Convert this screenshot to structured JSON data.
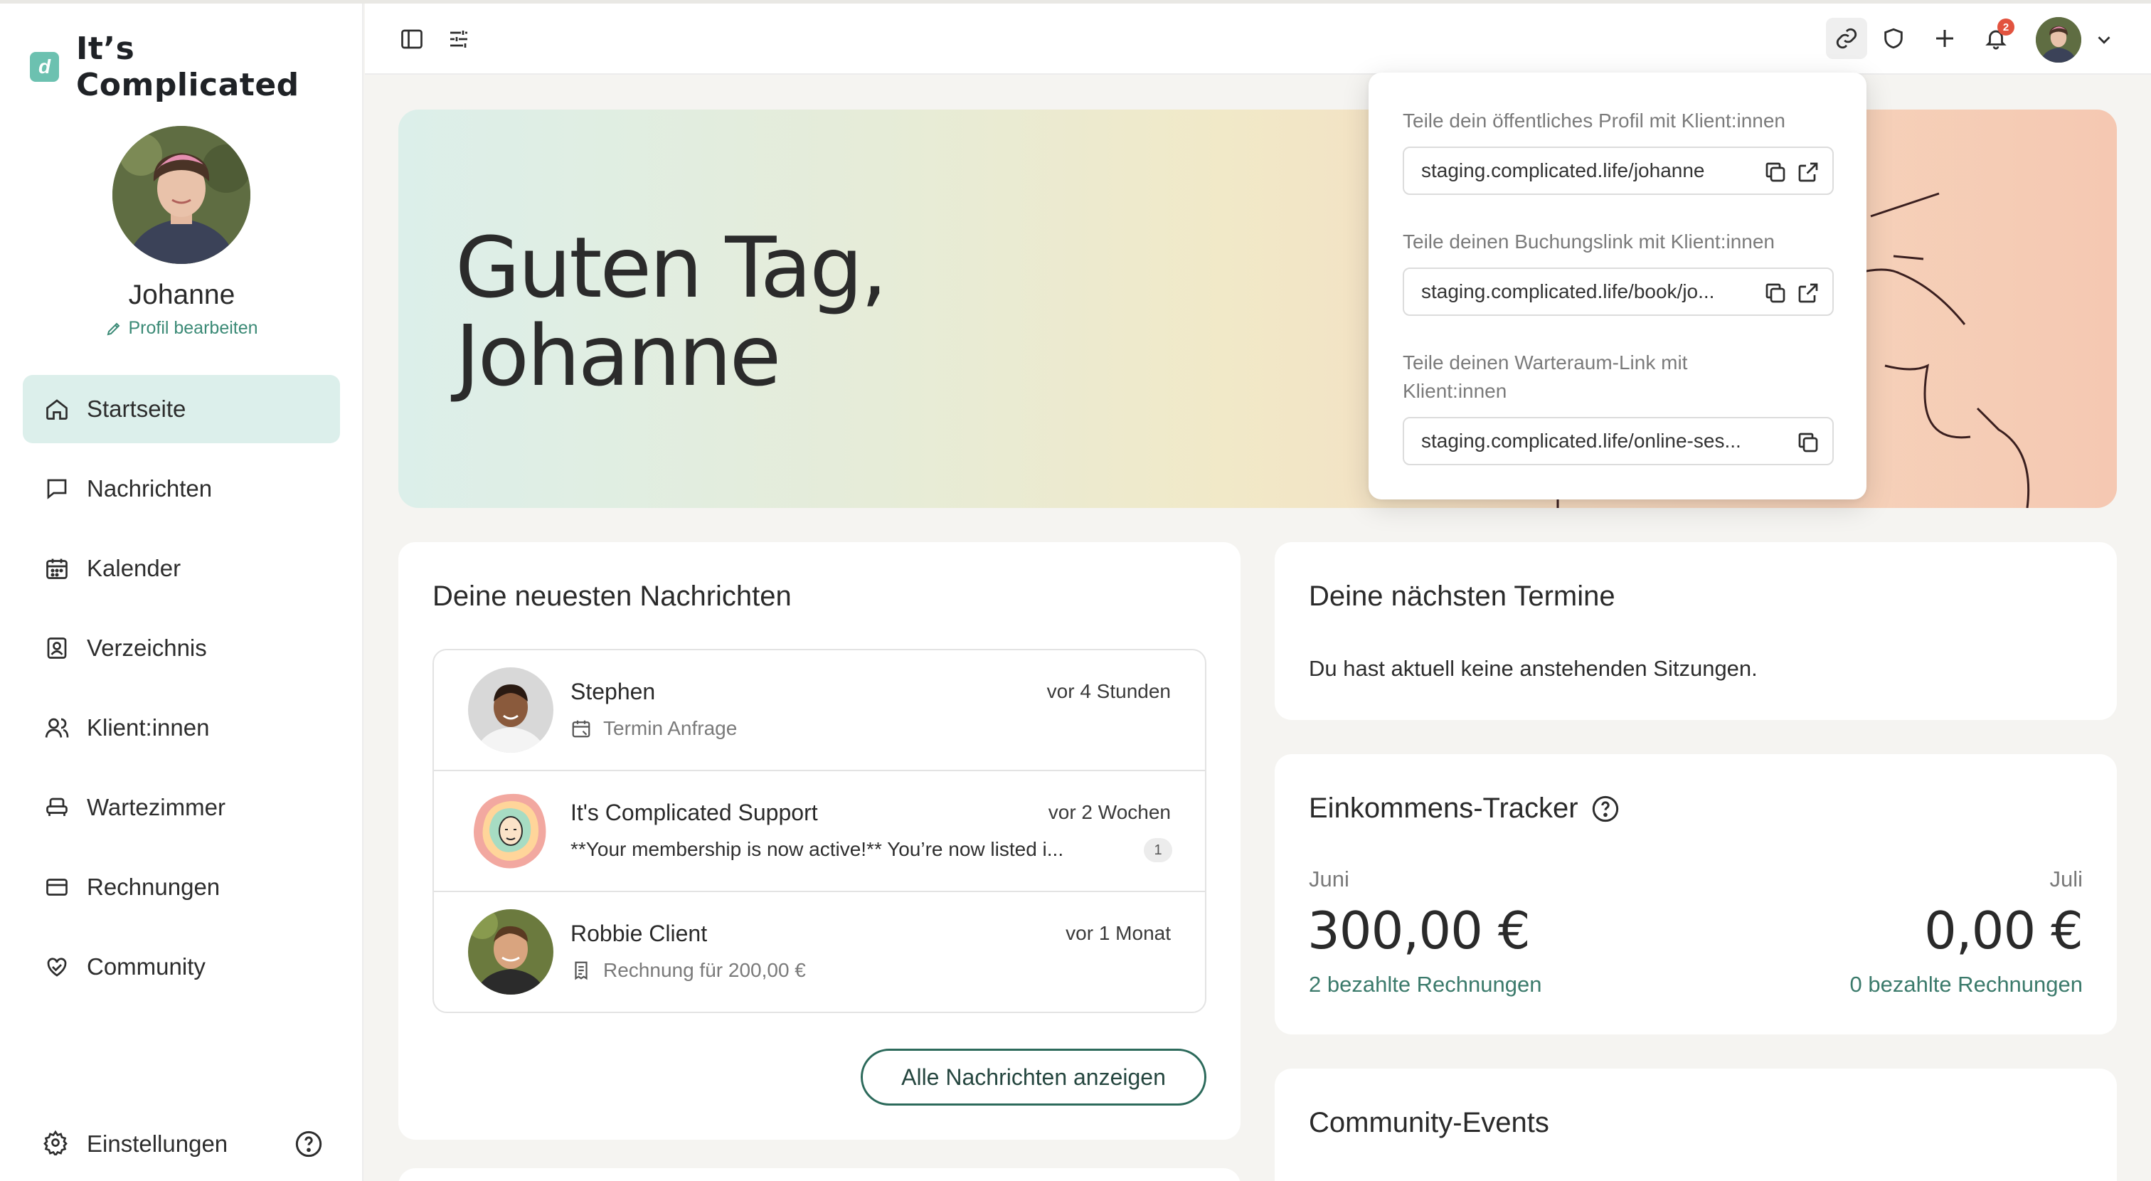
{
  "app": {
    "name": "It’s Complicated"
  },
  "profile": {
    "name": "Johanne",
    "edit_label": "Profil bearbeiten"
  },
  "sidebar": {
    "items": [
      {
        "label": "Startseite",
        "icon": "home-icon",
        "active": true
      },
      {
        "label": "Nachrichten",
        "icon": "chat-icon"
      },
      {
        "label": "Kalender",
        "icon": "calendar-icon"
      },
      {
        "label": "Verzeichnis",
        "icon": "directory-icon"
      },
      {
        "label": "Klient:innen",
        "icon": "clients-icon"
      },
      {
        "label": "Wartezimmer",
        "icon": "waiting-room-icon"
      },
      {
        "label": "Rechnungen",
        "icon": "invoice-icon"
      },
      {
        "label": "Community",
        "icon": "community-icon"
      }
    ],
    "settings_label": "Einstellungen"
  },
  "topbar": {
    "notification_count": "2"
  },
  "hero": {
    "greeting_line1": "Guten Tag,",
    "greeting_line2": "Johanne"
  },
  "share_popover": {
    "profile_label": "Teile dein öffentliches Profil mit Klient:innen",
    "profile_url": "staging.complicated.life/johanne",
    "booking_label": "Teile deinen Buchungslink mit Klient:innen",
    "booking_url": "staging.complicated.life/book/jo...",
    "waiting_label": "Teile deinen Warteraum-Link mit Klient:innen",
    "waiting_url": "staging.complicated.life/online-ses..."
  },
  "messages": {
    "title": "Deine neuesten Nachrichten",
    "items": [
      {
        "name": "Stephen",
        "time": "vor 4 Stunden",
        "subtitle": "Termin Anfrage",
        "icon": "calendar-icon"
      },
      {
        "name": "It's Complicated Support",
        "time": "vor 2 Wochen",
        "preview": "**Your membership is now active!** You’re now listed i...",
        "count": "1"
      },
      {
        "name": "Robbie Client",
        "time": "vor 1 Monat",
        "subtitle": "Rechnung für 200,00 €",
        "icon": "invoice-icon"
      }
    ],
    "show_all_label": "Alle Nachrichten anzeigen"
  },
  "appointments": {
    "title": "Deine nächsten Termine",
    "empty_text": "Du hast aktuell keine anstehenden Sitzungen."
  },
  "income": {
    "title": "Einkommens-Tracker",
    "left": {
      "month": "Juni",
      "amount": "300,00 €",
      "paid": "2 bezahlte Rechnungen"
    },
    "right": {
      "month": "Juli",
      "amount": "0,00 €",
      "paid": "0 bezahlte Rechnungen"
    }
  },
  "community_events": {
    "title": "Community-Events"
  },
  "colors": {
    "accent": "#3b8a76",
    "active_nav": "#dcefeb",
    "badge": "#e2533f"
  }
}
